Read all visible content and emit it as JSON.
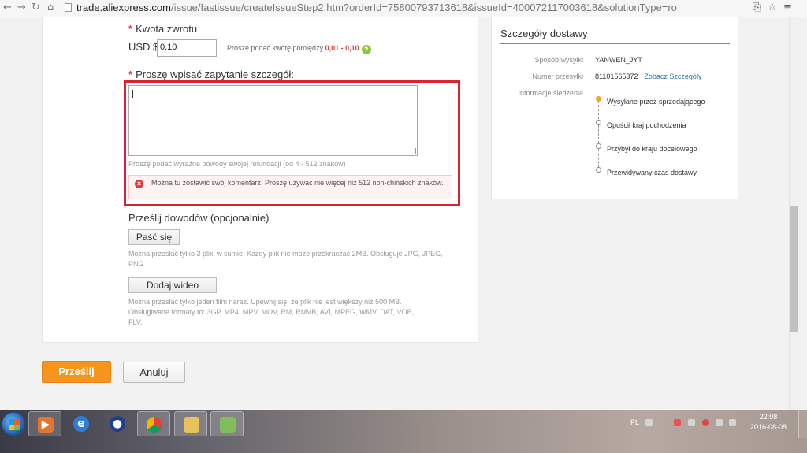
{
  "browser": {
    "url_host": "trade.aliexpress.com",
    "url_rest": "/issue/fastissue/createIssueStep2.htm?orderId=75800793713618&issueId=400072117003618&solutionType=ro"
  },
  "form": {
    "refund_label": "Kwota zwrotu",
    "currency": "USD $",
    "amount_value": "0.10",
    "amount_hint": "Proszę podać kwotę pomiędzy",
    "amount_range": "0,01 - 0,10",
    "details_label": "Proszę wpisać zapytanie szczegół:",
    "details_value": "",
    "details_hint": "Proszę podać wyraźne powody swojej refundacji (od 4 - 512 znaków)",
    "error_text": "Można tu zostawić swój komentarz. Proszę używać nie więcej niż 512 non-chińskich znaków.",
    "evidence_label": "Prześlij dowodów (opcjonalnie)",
    "upload_button": "Paść się",
    "upload_note": "Można przesłać tylko 3 pliki w sumie. Każdy plik nie może przekraczać 2MB. Obsługuje JPG, JPEG, PNG",
    "video_button": "Dodaj wideo",
    "video_note": "Można przesłać tylko jeden film naraz. Upewnij się, że plik nie jest większy niż 500 MB. Obsługiwane formaty to: 3GP, MP4, MPV, MOV, RM, RMVB, AVI, MPEG, WMV, DAT, VOB, FLV.",
    "submit": "Prześlij",
    "cancel": "Anuluj"
  },
  "shipping": {
    "title": "Szczegóły dostawy",
    "method_label": "Sposób wysyłki",
    "method_value": "YANWEN_JYT",
    "tracking_label": "Numer przesyłki",
    "tracking_value": "81101565372",
    "tracking_link": "Zobacz Szczegóły",
    "info_label": "Informacje śledzenia",
    "steps": [
      "Wysyłane przez sprzedającego",
      "Opuścił kraj pochodzenia",
      "Przybył do kraju docelowego",
      "Przewidywany czas dostawy"
    ]
  },
  "taskbar": {
    "lang": "PL",
    "time": "22:08",
    "date": "2016-08-08",
    "apps": [
      "media-player-icon",
      "internet-explorer-icon",
      "messenger-icon",
      "chrome-icon",
      "file-explorer-icon",
      "notes-app-icon"
    ]
  },
  "colors": {
    "accent_orange": "#f7941d",
    "error_red": "#e4393c",
    "link_blue": "#2a6ebb",
    "highlight_frame": "#d9232e"
  }
}
